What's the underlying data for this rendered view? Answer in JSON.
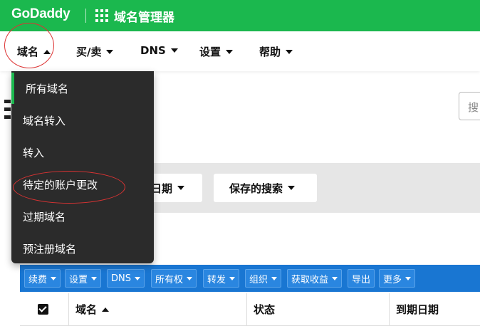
{
  "topbar": {
    "logo_text": "GoDaddy",
    "app_title": "域名管理器",
    "bg_color": "#1bb84e"
  },
  "nav": {
    "items": [
      {
        "label": "域名",
        "caret": "up"
      },
      {
        "label": "买/卖",
        "caret": "down"
      },
      {
        "label": "DNS",
        "caret": "down"
      },
      {
        "label": "设置",
        "caret": "down"
      },
      {
        "label": "帮助",
        "caret": "down"
      }
    ]
  },
  "dropdown": {
    "items": [
      {
        "label": "所有域名",
        "active": true
      },
      {
        "label": "域名转入"
      },
      {
        "label": "转入"
      },
      {
        "label": "待定的账户更改",
        "highlighted": true
      },
      {
        "label": "过期域名"
      },
      {
        "label": "预注册域名"
      }
    ]
  },
  "search": {
    "placeholder": "搜"
  },
  "filters": {
    "date_label": "日期",
    "saved_search_label": "保存的搜索"
  },
  "toolbar": {
    "buttons": [
      {
        "label": "续费",
        "caret": true
      },
      {
        "label": "设置",
        "caret": true
      },
      {
        "label": "DNS",
        "caret": true
      },
      {
        "label": "所有权",
        "caret": true
      },
      {
        "label": "转发",
        "caret": true
      },
      {
        "label": "组织",
        "caret": true
      },
      {
        "label": "获取收益",
        "caret": true
      },
      {
        "label": "导出",
        "caret": false
      },
      {
        "label": "更多",
        "caret": true
      }
    ],
    "accent": "#1976d2"
  },
  "table": {
    "headers": {
      "domain": "域名",
      "status": "状态",
      "expiry": "到期日期"
    }
  }
}
